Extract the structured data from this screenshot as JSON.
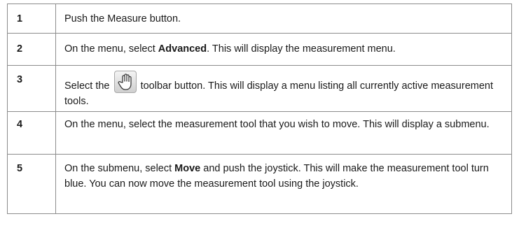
{
  "steps": [
    {
      "number": "1",
      "text": "Push the Measure button."
    },
    {
      "number": "2",
      "pre": "On the menu, select ",
      "bold": "Advanced",
      "post": ". This will display the measurement menu."
    },
    {
      "number": "3",
      "pre": "Select the",
      "icon": "hand-move-icon",
      "post": "toolbar button. This will display a menu listing all currently active measurement tools."
    },
    {
      "number": "4",
      "text": "On the menu, select the measurement tool that you wish to move. This will display a submenu."
    },
    {
      "number": "5",
      "pre": "On the submenu, select ",
      "bold": "Move",
      "post": " and push the joystick. This will make the measurement tool turn blue. You can now move the measurement tool using the joystick."
    }
  ]
}
